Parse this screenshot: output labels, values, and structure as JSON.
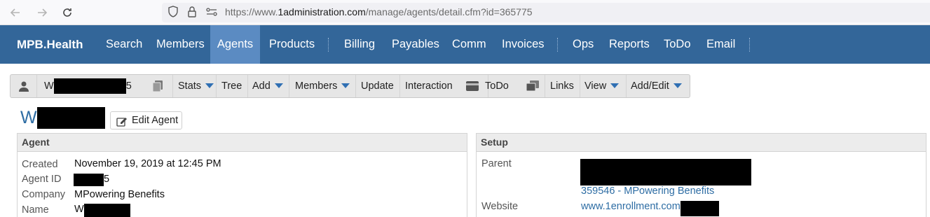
{
  "browser": {
    "url_prefix": "https://www.",
    "url_host": "1administration.com",
    "url_path": "/manage/agents/detail.cfm?id=365775",
    "back_icon": "arrow-left-icon",
    "forward_icon": "arrow-right-icon",
    "reload_icon": "reload-icon"
  },
  "topnav": {
    "brand": "MPB.Health",
    "items": [
      "Search",
      "Members",
      "Agents",
      "Products",
      "Billing",
      "Payables",
      "Comm",
      "Invoices",
      "Ops",
      "Reports",
      "ToDo",
      "Email"
    ],
    "active": "Agents",
    "color": "#336699",
    "active_color": "#5b8bc2"
  },
  "toolbar": {
    "agent_first_char": "W",
    "agent_last_char": "5",
    "stats": "Stats",
    "tree": "Tree",
    "add": "Add",
    "members": "Members",
    "update": "Update",
    "interaction": "Interaction",
    "todo": "ToDo",
    "links": "Links",
    "view": "View",
    "add_edit": "Add/Edit"
  },
  "title": {
    "first_char": "W",
    "edit_label": "Edit Agent"
  },
  "agent_panel": {
    "heading": "Agent",
    "created_label": "Created",
    "created_value": "November 19, 2019 at 12:45 PM",
    "agent_id_label": "Agent ID",
    "agent_id_suffix": "5",
    "company_label": "Company",
    "company_value": "MPowering Benefits",
    "name_label": "Name",
    "name_first_char": "W"
  },
  "setup_panel": {
    "heading": "Setup",
    "parent_label": "Parent",
    "parent_link": "359546 - MPowering Benefits",
    "website_label": "Website",
    "website_prefix": "www.1enrollment.com"
  }
}
